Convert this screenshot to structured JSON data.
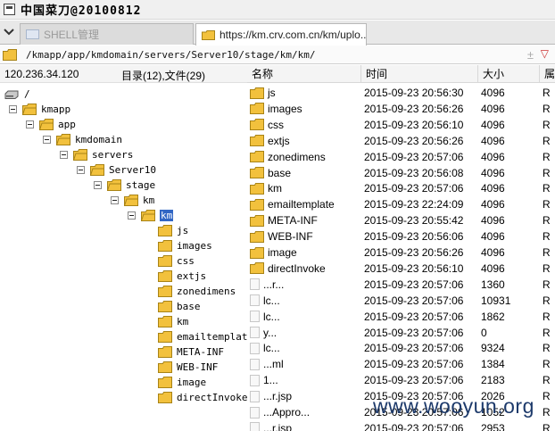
{
  "window": {
    "title": "中国菜刀@20100812"
  },
  "tabs": [
    {
      "label": "SHELL管理",
      "active": false
    },
    {
      "label": "https://km.crv.com.cn/km/uplo...",
      "active": true
    }
  ],
  "path_bar": {
    "path": "/kmapp/app/kmdomain/servers/Server10/stage/km/km/"
  },
  "left_panel": {
    "ip": "120.236.34.120",
    "counts": "目录(12),文件(29)",
    "tree": [
      {
        "label": "/",
        "type": "drive",
        "depth": 0
      },
      {
        "label": "kmapp",
        "type": "folder",
        "depth": 1,
        "expanded": true
      },
      {
        "label": "app",
        "type": "folder",
        "depth": 2,
        "expanded": true
      },
      {
        "label": "kmdomain",
        "type": "folder",
        "depth": 3,
        "expanded": true
      },
      {
        "label": "servers",
        "type": "folder",
        "depth": 4,
        "expanded": true
      },
      {
        "label": "Server10",
        "type": "folder",
        "depth": 5,
        "expanded": true
      },
      {
        "label": "stage",
        "type": "folder",
        "depth": 6,
        "expanded": true
      },
      {
        "label": "km",
        "type": "folder",
        "depth": 7,
        "expanded": true
      },
      {
        "label": "km",
        "type": "folder",
        "depth": 8,
        "expanded": true,
        "selected": true
      },
      {
        "label": "js",
        "type": "folder",
        "depth": 9
      },
      {
        "label": "images",
        "type": "folder",
        "depth": 9
      },
      {
        "label": "css",
        "type": "folder",
        "depth": 9
      },
      {
        "label": "extjs",
        "type": "folder",
        "depth": 9
      },
      {
        "label": "zonedimens",
        "type": "folder",
        "depth": 9
      },
      {
        "label": "base",
        "type": "folder",
        "depth": 9
      },
      {
        "label": "km",
        "type": "folder",
        "depth": 9
      },
      {
        "label": "emailtemplat",
        "type": "folder",
        "depth": 9
      },
      {
        "label": "META-INF",
        "type": "folder",
        "depth": 9
      },
      {
        "label": "WEB-INF",
        "type": "folder",
        "depth": 9
      },
      {
        "label": "image",
        "type": "folder",
        "depth": 9
      },
      {
        "label": "directInvoke",
        "type": "folder",
        "depth": 9
      }
    ]
  },
  "file_list": {
    "columns": {
      "name": "名称",
      "time": "时间",
      "size": "大小",
      "attr": "属"
    },
    "rows": [
      {
        "name": "js",
        "time": "2015-09-23 20:56:30",
        "size": "4096",
        "attr": "R",
        "type": "folder"
      },
      {
        "name": "images",
        "time": "2015-09-23 20:56:26",
        "size": "4096",
        "attr": "R",
        "type": "folder"
      },
      {
        "name": "css",
        "time": "2015-09-23 20:56:10",
        "size": "4096",
        "attr": "R",
        "type": "folder"
      },
      {
        "name": "extjs",
        "time": "2015-09-23 20:56:26",
        "size": "4096",
        "attr": "R",
        "type": "folder"
      },
      {
        "name": "zonedimens",
        "time": "2015-09-23 20:57:06",
        "size": "4096",
        "attr": "R",
        "type": "folder"
      },
      {
        "name": "base",
        "time": "2015-09-23 20:56:08",
        "size": "4096",
        "attr": "R",
        "type": "folder"
      },
      {
        "name": "km",
        "time": "2015-09-23 20:57:06",
        "size": "4096",
        "attr": "R",
        "type": "folder"
      },
      {
        "name": "emailtemplate",
        "time": "2015-09-23 22:24:09",
        "size": "4096",
        "attr": "R",
        "type": "folder"
      },
      {
        "name": "META-INF",
        "time": "2015-09-23 20:55:42",
        "size": "4096",
        "attr": "R",
        "type": "folder"
      },
      {
        "name": "WEB-INF",
        "time": "2015-09-23 20:56:06",
        "size": "4096",
        "attr": "R",
        "type": "folder"
      },
      {
        "name": "image",
        "time": "2015-09-23 20:56:26",
        "size": "4096",
        "attr": "R",
        "type": "folder"
      },
      {
        "name": "directInvoke",
        "time": "2015-09-23 20:56:10",
        "size": "4096",
        "attr": "R",
        "type": "folder"
      },
      {
        "name": "...r...",
        "time": "2015-09-23 20:57:06",
        "size": "1360",
        "attr": "R",
        "type": "file"
      },
      {
        "name": "lc...",
        "time": "2015-09-23 20:57:06",
        "size": "10931",
        "attr": "R",
        "type": "file"
      },
      {
        "name": "lc...",
        "time": "2015-09-23 20:57:06",
        "size": "1862",
        "attr": "R",
        "type": "file"
      },
      {
        "name": "y...",
        "time": "2015-09-23 20:57:06",
        "size": "0",
        "attr": "R",
        "type": "file"
      },
      {
        "name": "lc...",
        "time": "2015-09-23 20:57:06",
        "size": "9324",
        "attr": "R",
        "type": "file"
      },
      {
        "name": "...ml",
        "time": "2015-09-23 20:57:06",
        "size": "1384",
        "attr": "R",
        "type": "file"
      },
      {
        "name": "1...",
        "time": "2015-09-23 20:57:06",
        "size": "2183",
        "attr": "R",
        "type": "file"
      },
      {
        "name": "...r.jsp",
        "time": "2015-09-23 20:57:06",
        "size": "2026",
        "attr": "R",
        "type": "file"
      },
      {
        "name": "...Appro...",
        "time": "2015-09-23 20:57:06",
        "size": "1052",
        "attr": "R",
        "type": "file"
      },
      {
        "name": "...r.jsp",
        "time": "2015-09-23 20:57:06",
        "size": "2953",
        "attr": "R",
        "type": "file"
      }
    ]
  },
  "watermark": "www.wooyun.org",
  "colors": {
    "selection": "#3166c4",
    "folder": "#f2c13d",
    "watermark": "#1d3a6b"
  }
}
